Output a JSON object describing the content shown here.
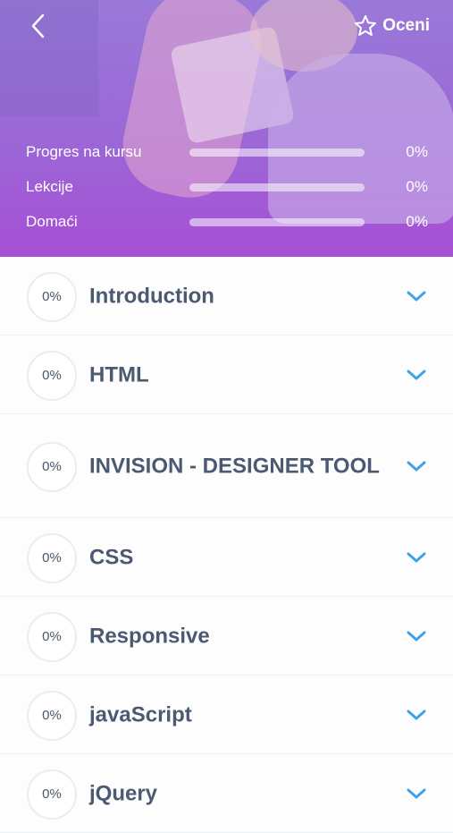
{
  "header": {
    "rate_label": "Oceni",
    "stats": [
      {
        "label": "Progres na kursu",
        "value": "0%",
        "progress": 0
      },
      {
        "label": "Lekcije",
        "value": "0%",
        "progress": 0
      },
      {
        "label": "Domaći",
        "value": "0%",
        "progress": 0
      }
    ]
  },
  "modules": [
    {
      "percent": "0%",
      "title": "Introduction"
    },
    {
      "percent": "0%",
      "title": "HTML"
    },
    {
      "percent": "0%",
      "title": "INVISION - DESIGNER TOOL"
    },
    {
      "percent": "0%",
      "title": "CSS"
    },
    {
      "percent": "0%",
      "title": "Responsive"
    },
    {
      "percent": "0%",
      "title": "javaScript"
    },
    {
      "percent": "0%",
      "title": "jQuery"
    }
  ],
  "colors": {
    "accent": "#3fa3e6",
    "header_top": "#9a79d9",
    "header_bottom": "#a74fd6",
    "title": "#4b5a70"
  }
}
